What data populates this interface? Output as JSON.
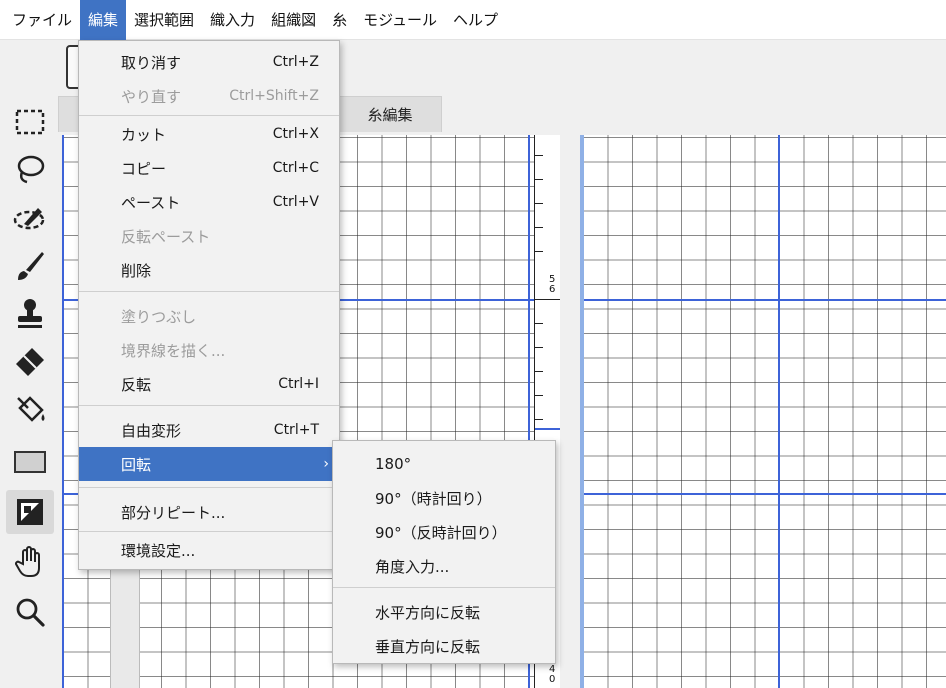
{
  "menubar": {
    "items": [
      "ファイル",
      "編集",
      "選択範囲",
      "織入力",
      "組織図",
      "糸",
      "モジュール",
      "ヘルプ"
    ]
  },
  "tabs": {
    "thread_edit": "糸編集"
  },
  "edit_menu": {
    "items": [
      {
        "label": "取り消す",
        "shortcut": "Ctrl+Z",
        "enabled": true
      },
      {
        "label": "やり直す",
        "shortcut": "Ctrl+Shift+Z",
        "enabled": false
      },
      {
        "label": "カット",
        "shortcut": "Ctrl+X",
        "enabled": true
      },
      {
        "label": "コピー",
        "shortcut": "Ctrl+C",
        "enabled": true
      },
      {
        "label": "ペースト",
        "shortcut": "Ctrl+V",
        "enabled": true
      },
      {
        "label": "反転ペースト",
        "shortcut": "",
        "enabled": false
      },
      {
        "label": "削除",
        "shortcut": "",
        "enabled": true
      },
      {
        "label": "塗りつぶし",
        "shortcut": "",
        "enabled": false
      },
      {
        "label": "境界線を描く...",
        "shortcut": "",
        "enabled": false
      },
      {
        "label": "反転",
        "shortcut": "Ctrl+I",
        "enabled": true
      },
      {
        "label": "自由変形",
        "shortcut": "Ctrl+T",
        "enabled": true
      },
      {
        "label": "回転",
        "shortcut": "",
        "enabled": true,
        "highlighted": true,
        "has_submenu": true
      },
      {
        "label": "部分リピート...",
        "shortcut": "",
        "enabled": true
      },
      {
        "label": "環境設定...",
        "shortcut": "",
        "enabled": true
      }
    ],
    "submenu_arrow": "›"
  },
  "rotate_submenu": {
    "items": [
      "180°",
      "90°（時計回り）",
      "90°（反時計回り）",
      "角度入力...",
      "水平方向に反転",
      "垂直方向に反転"
    ]
  },
  "ruler": {
    "labels": [
      "5",
      "6",
      "4",
      "0"
    ]
  },
  "tools": [
    "rect-select-icon",
    "lasso-icon",
    "eye-dropper-icon",
    "brush-icon",
    "stamp-icon",
    "eraser-icon",
    "fill-bucket-icon",
    "rectangle-icon",
    "invert-icon",
    "hand-icon",
    "zoom-icon"
  ],
  "colors": {
    "accent": "#3f73c4",
    "grid_blue": "#3d63d8",
    "disabled": "#9c9c9c"
  }
}
